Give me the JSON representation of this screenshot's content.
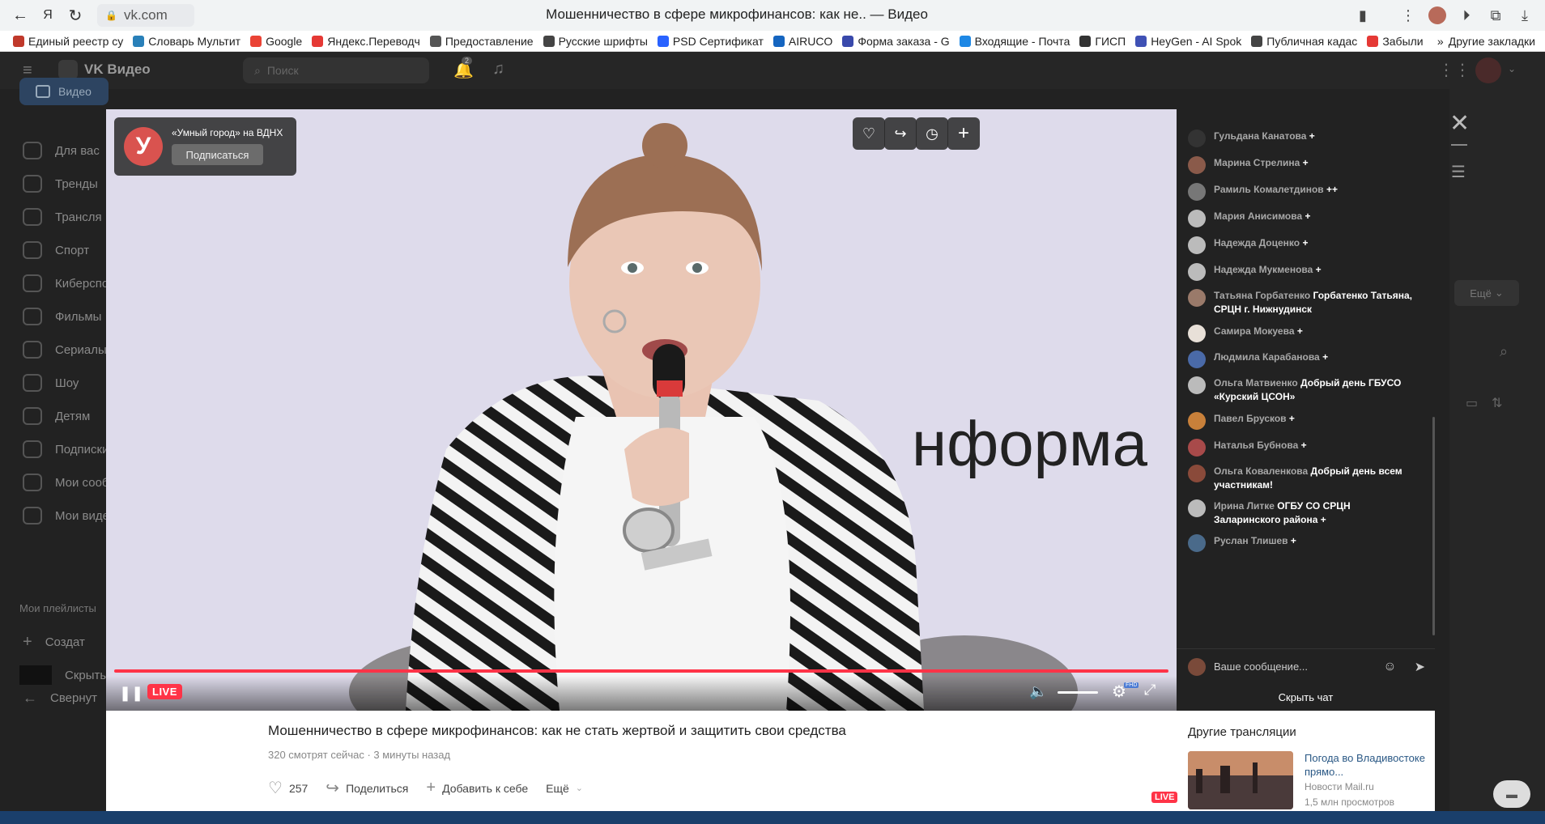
{
  "browser": {
    "url": "vk.com",
    "tab_title": "Мошенничество в сфере микрофинансов: как не.. — Видео",
    "bookmarks": [
      {
        "label": "Единый реестр су",
        "color": "#c0392b"
      },
      {
        "label": "Словарь Мультит",
        "color": "#2980b9"
      },
      {
        "label": "Google",
        "color": "#ea4335"
      },
      {
        "label": "Яндекс.Переводч",
        "color": "#e53935"
      },
      {
        "label": "Предоставление",
        "color": "#555555"
      },
      {
        "label": "Русские шрифты",
        "color": "#444444"
      },
      {
        "label": "PSD Сертификат",
        "color": "#2962ff"
      },
      {
        "label": "AIRUCO",
        "color": "#1565c0"
      },
      {
        "label": "Форма заказа - G",
        "color": "#3949ab"
      },
      {
        "label": "Входящие - Почта",
        "color": "#1e88e5"
      },
      {
        "label": "ГИСП",
        "color": "#333333"
      },
      {
        "label": "HeyGen - AI Spok",
        "color": "#3f51b5"
      },
      {
        "label": "Публичная кадас",
        "color": "#444444"
      },
      {
        "label": "Забыли",
        "color": "#e53935"
      }
    ],
    "other_bookmarks": "Другие закладки"
  },
  "vk": {
    "logo": "VK Видео",
    "search_placeholder": "Поиск",
    "notif_count": "2",
    "side_video": "Видео",
    "sidebar": [
      "Для вас",
      "Тренды",
      "Трансля",
      "Спорт",
      "Киберспо",
      "Фильмы",
      "Сериалы",
      "Шоу",
      "Детям",
      "Подписки",
      "Мои сооб",
      "Мои виде"
    ],
    "playlists_label": "Мои плейлисты",
    "create_label": "Создат",
    "hidden_label": "Скрыты",
    "collapse_label": "Свернут",
    "more_label": "Ещё"
  },
  "player": {
    "channel_name": "«Умный город» на ВДНХ",
    "channel_letter": "У",
    "subscribe": "Подписаться",
    "background_text": "нформа",
    "live": "LIVE",
    "hd": "FHD"
  },
  "chat": {
    "messages": [
      {
        "name": "Гульдана Канатова",
        "text": "+",
        "avatar": "#333333"
      },
      {
        "name": "Марина Стрелина",
        "text": "+",
        "avatar": "#8a5a4a"
      },
      {
        "name": "Рамиль Комалетдинов",
        "text": "++",
        "avatar": "#777777"
      },
      {
        "name": "Мария Анисимова",
        "text": "+",
        "avatar": "#bbbbbb"
      },
      {
        "name": "Надежда Доценко",
        "text": "+",
        "avatar": "#bbbbbb"
      },
      {
        "name": "Надежда Мукменова",
        "text": "+",
        "avatar": "#bbbbbb"
      },
      {
        "name": "Татьяна Горбатенко",
        "text": "Горбатенко Татьяна, СРЦН г. Нижнудинск",
        "avatar": "#9a7a6a"
      },
      {
        "name": "Самира Мокуева",
        "text": "+",
        "avatar": "#e8e0d8"
      },
      {
        "name": "Людмила Карабанова",
        "text": "+",
        "avatar": "#4a6aa8"
      },
      {
        "name": "Ольга Матвиенко",
        "text": "Добрый день ГБУСО «Курский ЦСОН»",
        "avatar": "#bbbbbb"
      },
      {
        "name": "Павел Брусков",
        "text": "+",
        "avatar": "#c8803a"
      },
      {
        "name": "Наталья Бубнова",
        "text": "+",
        "avatar": "#a84a4a"
      },
      {
        "name": "Ольга Коваленкова",
        "text": "Добрый день всем участникам!",
        "avatar": "#8a4a3a"
      },
      {
        "name": "Ирина Литке",
        "text": "ОГБУ СО СРЦН Заларинского района +",
        "avatar": "#bbbbbb"
      },
      {
        "name": "Руслан Тлишев",
        "text": "+",
        "avatar": "#4a6a8a"
      }
    ],
    "input_placeholder": "Ваше сообщение...",
    "hide_chat": "Скрыть чат"
  },
  "video": {
    "title": "Мошенничество в сфере микрофинансов: как не стать жертвой и защитить свои средства",
    "viewers": "320 смотрят сейчас",
    "time": "3 минуты назад",
    "likes": "257",
    "share": "Поделиться",
    "add": "Добавить к себе",
    "more": "Ещё"
  },
  "other": {
    "heading": "Другие трансляции",
    "title": "Погода во Владивостоке прямо...",
    "source": "Новости Mail.ru",
    "views": "1,5 млн просмотров",
    "live": "LIVE"
  }
}
